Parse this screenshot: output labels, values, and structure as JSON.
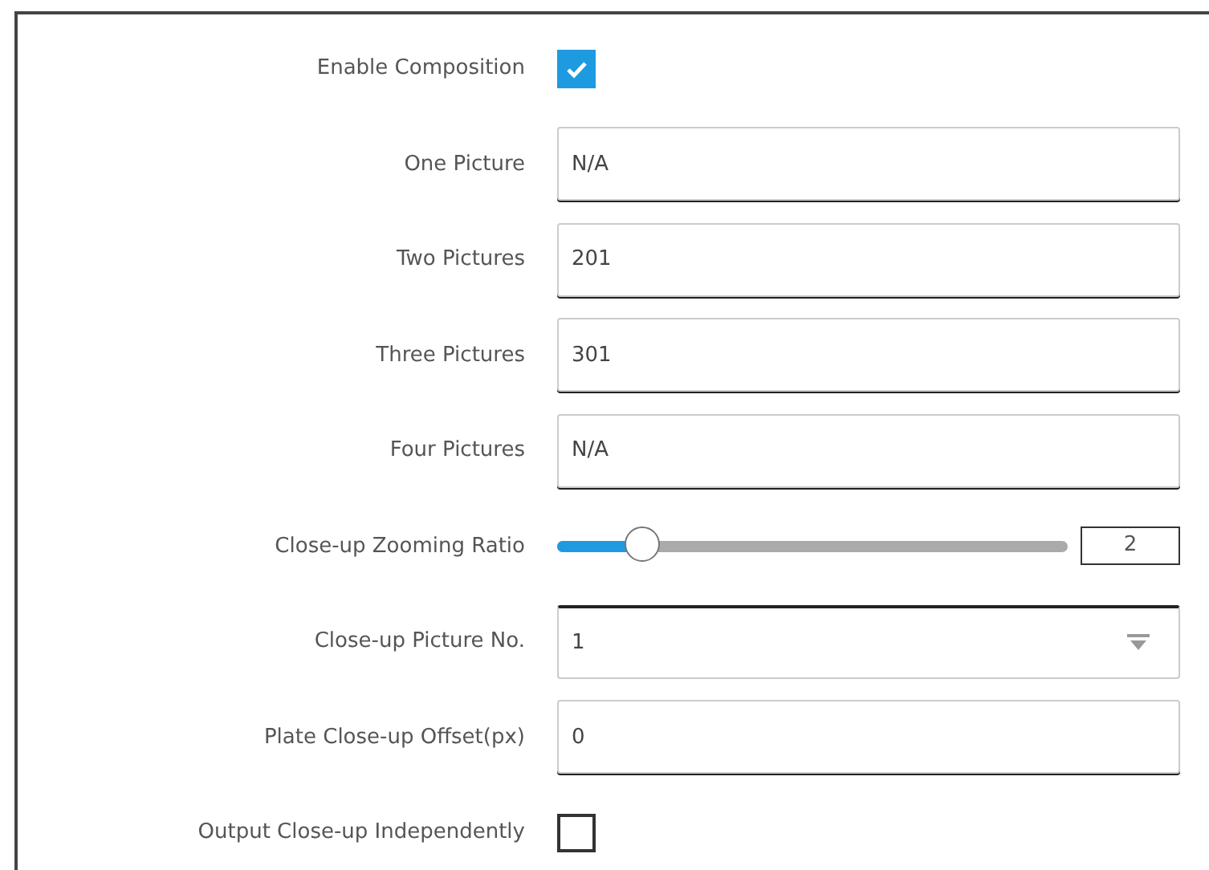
{
  "rows": [
    {
      "kind": "checkbox",
      "label": "Enable Composition",
      "checked": true
    },
    {
      "kind": "text",
      "label": "One Picture",
      "value": "N/A"
    },
    {
      "kind": "text",
      "label": "Two Pictures",
      "value": "201"
    },
    {
      "kind": "text",
      "label": "Three Pictures",
      "value": "301"
    },
    {
      "kind": "text",
      "label": "Four Pictures",
      "value": "N/A"
    },
    {
      "kind": "slider",
      "label": "Close-up Zooming Ratio",
      "level": 0.17,
      "reading": "2"
    },
    {
      "kind": "select",
      "label": "Close-up Picture No.",
      "value": "1"
    },
    {
      "kind": "text",
      "label": "Plate Close-up Offset(px)",
      "value": "0"
    },
    {
      "kind": "checkbox",
      "label": "Output Close-up Independently",
      "checked": false
    }
  ]
}
